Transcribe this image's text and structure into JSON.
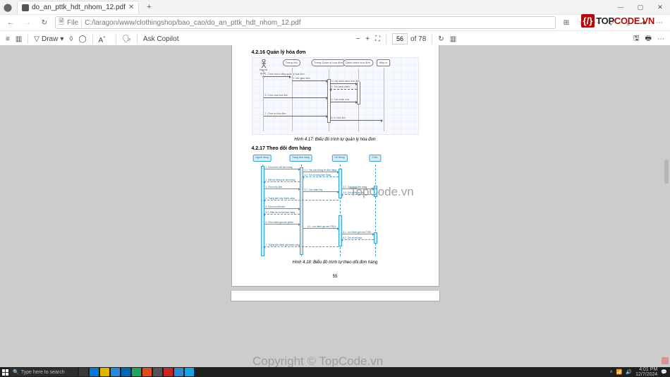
{
  "window": {
    "tab_title": "do_an_pttk_hdt_nhom_12.pdf",
    "min": "—",
    "max": "▢",
    "close": "✕"
  },
  "addressbar": {
    "back": "←",
    "forward": "→",
    "reload": "↻",
    "scheme_icon": "🗎",
    "scheme": "File",
    "url": "C:/laragon/www/clothingshop/bao_cao/do_an_pttk_hdt_nhom_12.pdf",
    "icons": {
      "read": "⊞",
      "fav": "☆",
      "ext": "⋯",
      "apps": "⤢",
      "menu": "⋯",
      "dl": "⤓",
      "prof": "●"
    }
  },
  "pdf_toolbar": {
    "toc": "≡",
    "page_nav": "▥",
    "draw": "Draw",
    "draw_icon": "▽",
    "highlight": "◊",
    "erase": "◯",
    "text_size": "A゛",
    "readaloud": "🗣",
    "copilot": "Ask Copilot",
    "zoom_out": "−",
    "zoom_in": "+",
    "fit": "⛶",
    "current_page": "56",
    "of": "of 78",
    "rotate": "↻",
    "view": "▥",
    "save": "🖫",
    "print": "🖶",
    "more": "⋯"
  },
  "document": {
    "sec1_heading": "4.2.16 Quản lý hóa đơn",
    "diagram1": {
      "actors": {
        "a1": "Người quản trị",
        "h1": "Trang chủ",
        "h2": "Trang Quản lý\nhóa đơn",
        "h3": "Danh sách\nhóa đơn",
        "h4": "Máy in"
      },
      "msgs": {
        "m1": "1. Chọn chức năng\nquản lý hóa đơn",
        "m2": "2. Mở giao diện",
        "m3": "3. Lấy danh sách hóa đơn",
        "m3r": "4. Trả danh sách",
        "m4": "5. Chọn xóa hóa đơn",
        "m5": "6. Xác nhận xóa",
        "m6": "7. Chọn in hóa đơn",
        "m7": "8. In hóa đơn"
      }
    },
    "caption1": "Hình 4.17: Biểu đồ trình tự quản lý hóa đơn",
    "sec2_heading": "4.2.17 Theo dõi đơn hàng",
    "diagram2": {
      "heads": {
        "h1": "Người dùng",
        "h2": "Trang đơn hàng",
        "h3": "Hệ thống",
        "h4": "CSDL"
      },
      "msgs": {
        "m1": "1. Chọn theo dõi đơn hàng",
        "m2": "1.1. Yêu cầu thông tin đơn hàng",
        "m2r": "1.2. Trả về trang đơn hàng",
        "m3": "2. Hiển thị thông tin đơn hàng",
        "m4": "3. Chọn hủy đơn",
        "m5": "3.1. Xác nhận hủy",
        "m6": "3.2. Cập nhật đơn hàng",
        "m6r": "3.3. Trả về thông báo",
        "m7": "4. Thông báo hủy thành công",
        "m8": "5. Chọn chi tiết đơn",
        "m9": "5.1. Hiển thị chi tiết đơn hàng",
        "m10": "6. Chọn đánh giá sản phẩm",
        "m11": "6.1. Lưu đánh giá vào CSDL",
        "m11r": "6.2. Trả về kết quả",
        "m12": "7. Thông báo đánh giá thành công"
      }
    },
    "caption2": "Hình 4.18: Biểu đồ trình tự theo dõi đơn hàng",
    "page_number": "55"
  },
  "watermarks": {
    "wm1": "TopCode.vn",
    "wm2": "Copyright © TopCode.vn",
    "logo_bracket": "{/}",
    "logo_a": "TOP",
    "logo_b": "CODE.VN"
  },
  "taskbar": {
    "search_placeholder": "Type here to search",
    "time": "4:01 PM",
    "date": "12/7/2024"
  }
}
